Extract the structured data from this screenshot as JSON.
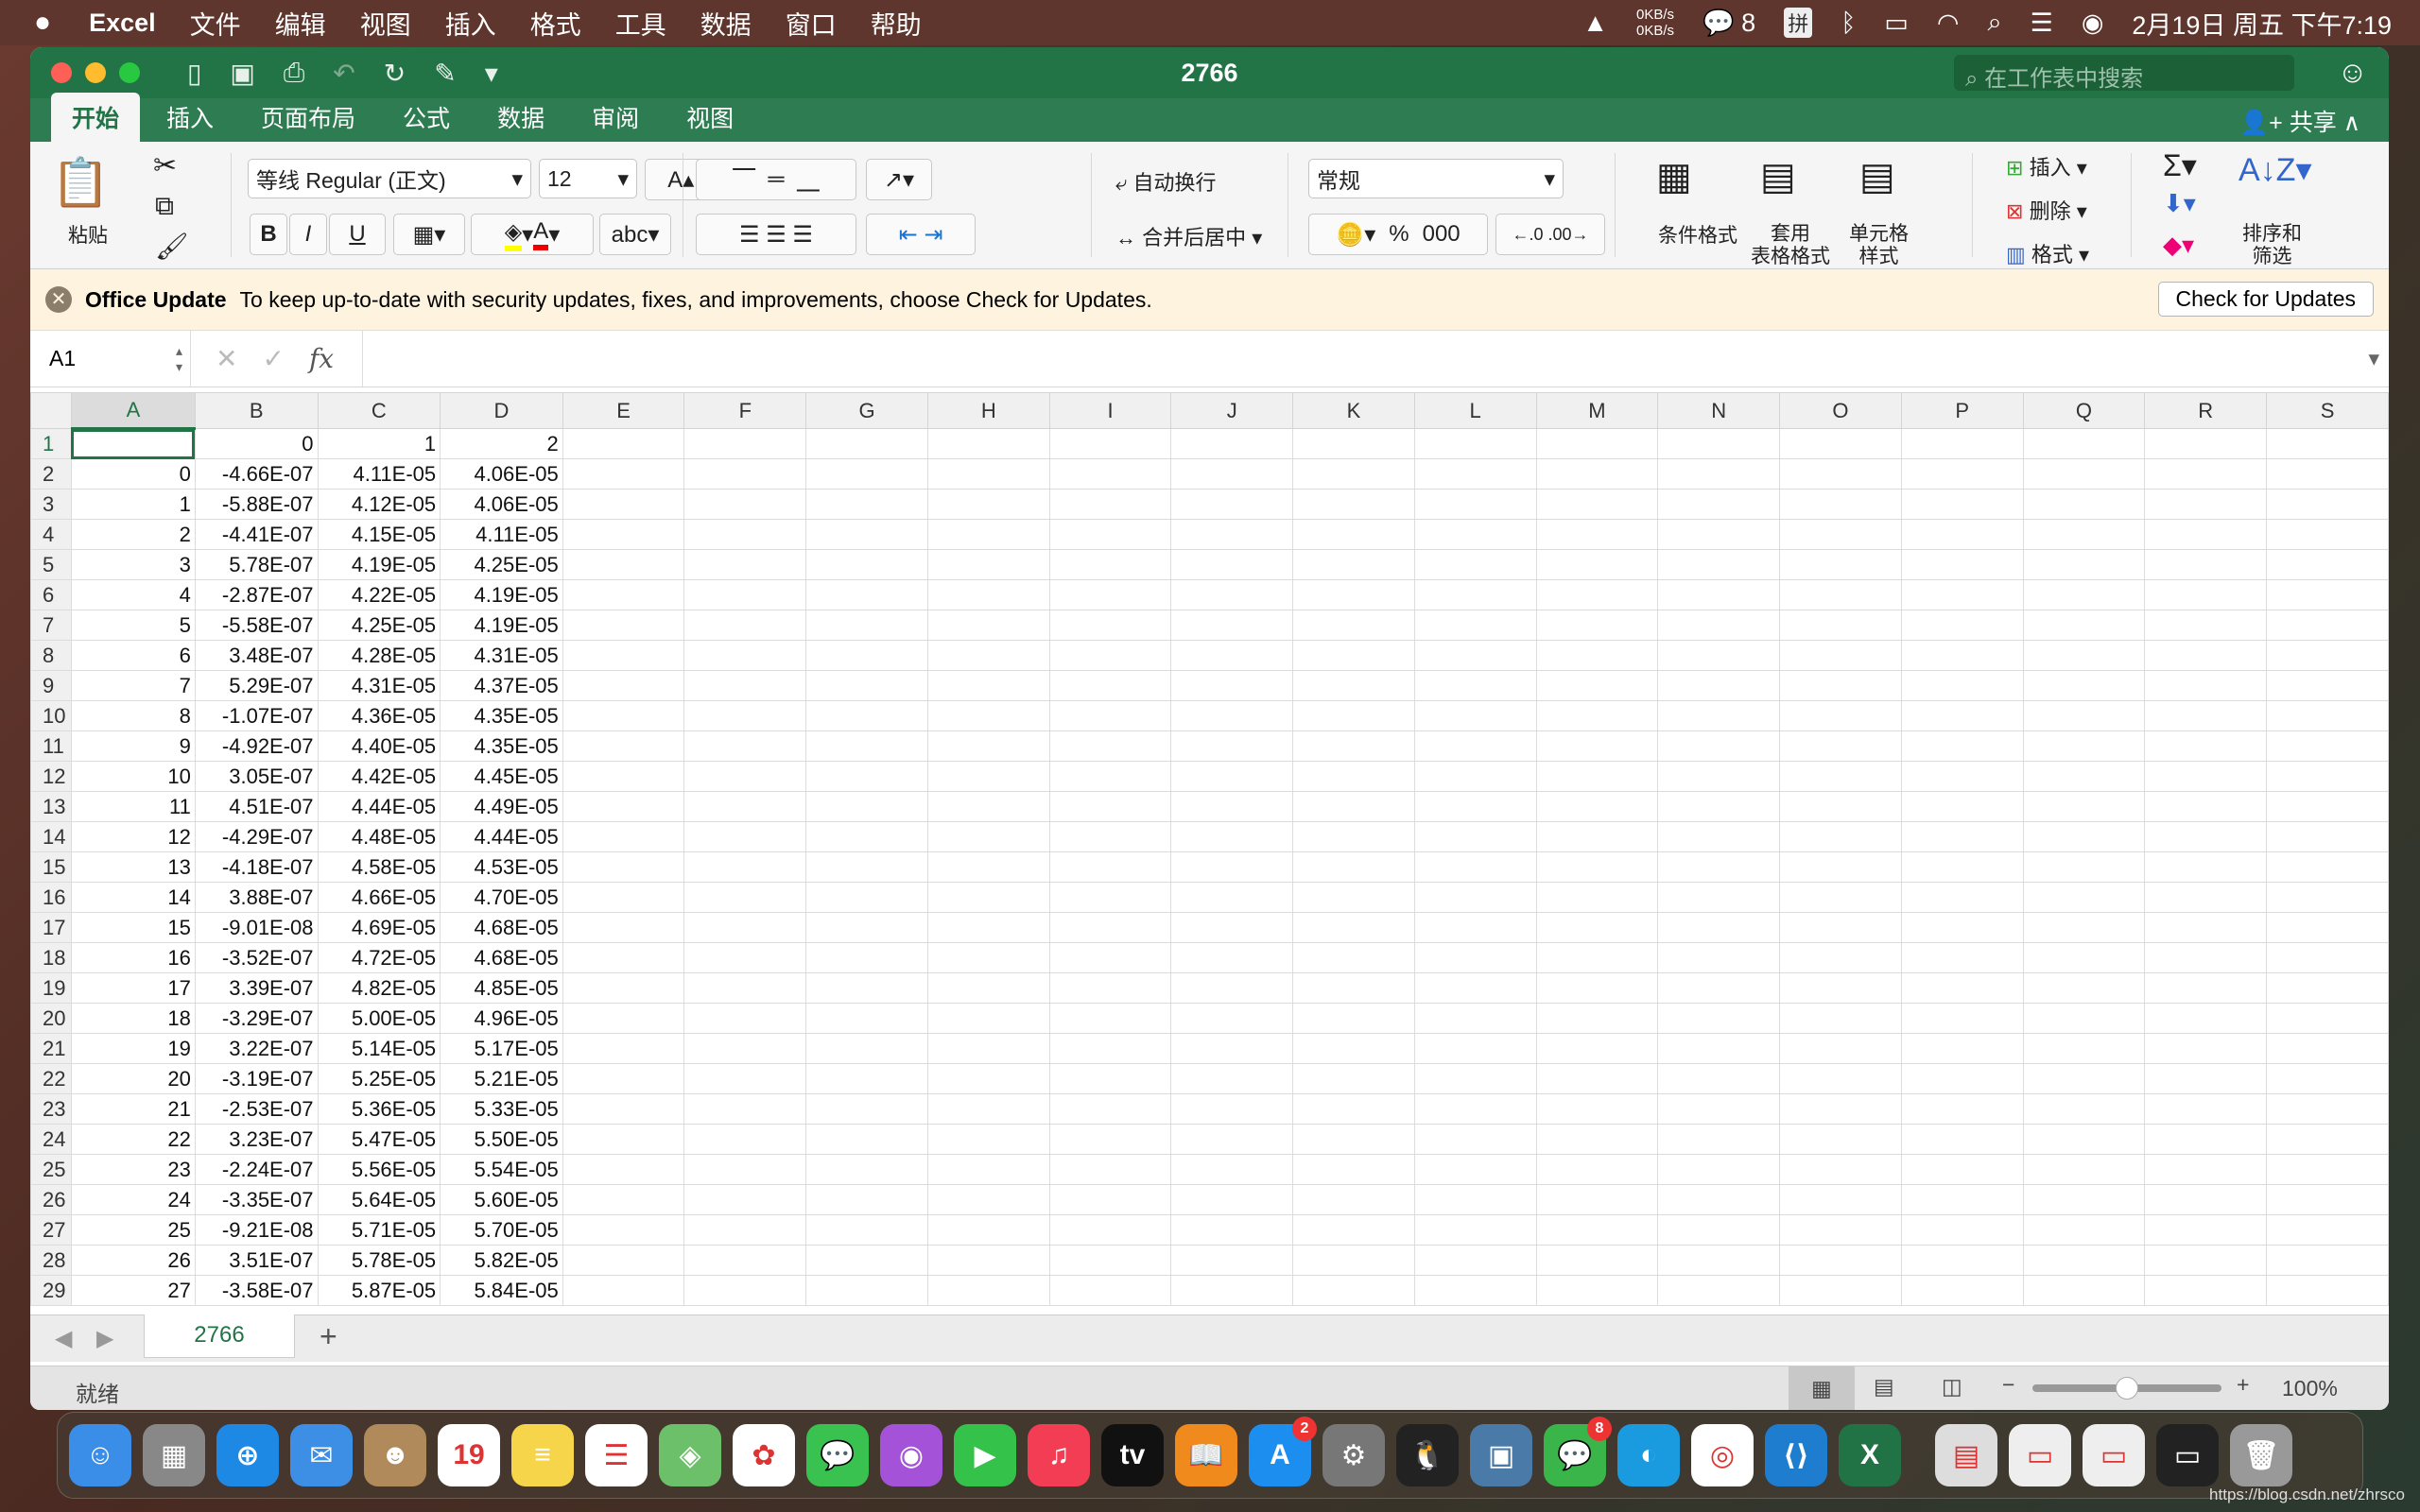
{
  "menubar": {
    "app": "Excel",
    "items": [
      "文件",
      "编辑",
      "视图",
      "插入",
      "格式",
      "工具",
      "数据",
      "窗口",
      "帮助"
    ],
    "net_up": "0KB/s",
    "net_down": "0KB/s",
    "wechat_count": "8",
    "ime": "拼",
    "clock": "2月19日 周五 下午7:19"
  },
  "window": {
    "title": "2766",
    "search_placeholder": "在工作表中搜索",
    "share": "共享"
  },
  "tabs": [
    "开始",
    "插入",
    "页面布局",
    "公式",
    "数据",
    "审阅",
    "视图"
  ],
  "ribbon": {
    "paste": "粘贴",
    "font": "等线 Regular (正文)",
    "size": "12",
    "bold": "B",
    "italic": "I",
    "underline": "U",
    "wrap": "自动换行",
    "merge": "合并后居中",
    "number_format": "常规",
    "percent": "%",
    "thousands": "000",
    "cond_format": "条件格式",
    "table_format_1": "套用",
    "table_format_2": "表格格式",
    "cell_style_1": "单元格",
    "cell_style_2": "样式",
    "insert": "插入",
    "delete": "删除",
    "format": "格式",
    "sort_1": "排序和",
    "sort_2": "筛选"
  },
  "update_bar": {
    "title": "Office Update",
    "message": "To keep up-to-date with security updates, fixes, and improvements, choose Check for Updates.",
    "button": "Check for Updates"
  },
  "formula_bar": {
    "name_box": "A1",
    "fx": "fx",
    "value": ""
  },
  "sheet": {
    "columns": [
      "A",
      "B",
      "C",
      "D",
      "E",
      "F",
      "G",
      "H",
      "I",
      "J",
      "K",
      "L",
      "M",
      "N",
      "O",
      "P",
      "Q",
      "R",
      "S"
    ],
    "selected": "A1",
    "rows": [
      [
        "",
        "0",
        "1",
        "2"
      ],
      [
        "0",
        "-4.66E-07",
        "4.11E-05",
        "4.06E-05"
      ],
      [
        "1",
        "-5.88E-07",
        "4.12E-05",
        "4.06E-05"
      ],
      [
        "2",
        "-4.41E-07",
        "4.15E-05",
        "4.11E-05"
      ],
      [
        "3",
        "5.78E-07",
        "4.19E-05",
        "4.25E-05"
      ],
      [
        "4",
        "-2.87E-07",
        "4.22E-05",
        "4.19E-05"
      ],
      [
        "5",
        "-5.58E-07",
        "4.25E-05",
        "4.19E-05"
      ],
      [
        "6",
        "3.48E-07",
        "4.28E-05",
        "4.31E-05"
      ],
      [
        "7",
        "5.29E-07",
        "4.31E-05",
        "4.37E-05"
      ],
      [
        "8",
        "-1.07E-07",
        "4.36E-05",
        "4.35E-05"
      ],
      [
        "9",
        "-4.92E-07",
        "4.40E-05",
        "4.35E-05"
      ],
      [
        "10",
        "3.05E-07",
        "4.42E-05",
        "4.45E-05"
      ],
      [
        "11",
        "4.51E-07",
        "4.44E-05",
        "4.49E-05"
      ],
      [
        "12",
        "-4.29E-07",
        "4.48E-05",
        "4.44E-05"
      ],
      [
        "13",
        "-4.18E-07",
        "4.58E-05",
        "4.53E-05"
      ],
      [
        "14",
        "3.88E-07",
        "4.66E-05",
        "4.70E-05"
      ],
      [
        "15",
        "-9.01E-08",
        "4.69E-05",
        "4.68E-05"
      ],
      [
        "16",
        "-3.52E-07",
        "4.72E-05",
        "4.68E-05"
      ],
      [
        "17",
        "3.39E-07",
        "4.82E-05",
        "4.85E-05"
      ],
      [
        "18",
        "-3.29E-07",
        "5.00E-05",
        "4.96E-05"
      ],
      [
        "19",
        "3.22E-07",
        "5.14E-05",
        "5.17E-05"
      ],
      [
        "20",
        "-3.19E-07",
        "5.25E-05",
        "5.21E-05"
      ],
      [
        "21",
        "-2.53E-07",
        "5.36E-05",
        "5.33E-05"
      ],
      [
        "22",
        "3.23E-07",
        "5.47E-05",
        "5.50E-05"
      ],
      [
        "23",
        "-2.24E-07",
        "5.56E-05",
        "5.54E-05"
      ],
      [
        "24",
        "-3.35E-07",
        "5.64E-05",
        "5.60E-05"
      ],
      [
        "25",
        "-9.21E-08",
        "5.71E-05",
        "5.70E-05"
      ],
      [
        "26",
        "3.51E-07",
        "5.78E-05",
        "5.82E-05"
      ],
      [
        "27",
        "-3.58E-07",
        "5.87E-05",
        "5.84E-05"
      ]
    ],
    "tab": "2766",
    "add_sheet": "+"
  },
  "status": {
    "text": "就绪",
    "zoom": "100%",
    "zoom_percent": 100
  },
  "dock": {
    "apps": [
      {
        "name": "finder",
        "color": "#3b8ee8",
        "glyph": "☺"
      },
      {
        "name": "launchpad",
        "color": "#888",
        "glyph": "▦"
      },
      {
        "name": "safari",
        "color": "#1e88e5",
        "glyph": "⊕"
      },
      {
        "name": "mail",
        "color": "#3d8fe6",
        "glyph": "✉"
      },
      {
        "name": "contacts",
        "color": "#b08a5a",
        "glyph": "☻"
      },
      {
        "name": "calendar",
        "color": "#fff",
        "glyph": "19"
      },
      {
        "name": "notes",
        "color": "#f6d54a",
        "glyph": "≡"
      },
      {
        "name": "reminders",
        "color": "#fff",
        "glyph": "☰"
      },
      {
        "name": "maps",
        "color": "#6cc06a",
        "glyph": "◈"
      },
      {
        "name": "photos",
        "color": "#fff",
        "glyph": "✿"
      },
      {
        "name": "messages",
        "color": "#3ac250",
        "glyph": "💬"
      },
      {
        "name": "podcasts",
        "color": "#a453d8",
        "glyph": "◉"
      },
      {
        "name": "facetime",
        "color": "#35c24a",
        "glyph": "▶"
      },
      {
        "name": "music",
        "color": "#f33d54",
        "glyph": "♫"
      },
      {
        "name": "tv",
        "color": "#111",
        "glyph": "tv"
      },
      {
        "name": "books",
        "color": "#f08a1c",
        "glyph": "📖"
      },
      {
        "name": "app-store",
        "color": "#1c8ef0",
        "glyph": "A",
        "badge": "2"
      },
      {
        "name": "system-preferences",
        "color": "#777",
        "glyph": "⚙"
      },
      {
        "name": "qq",
        "color": "#222",
        "glyph": "🐧"
      },
      {
        "name": "preview",
        "color": "#4a7aa8",
        "glyph": "▣"
      },
      {
        "name": "wechat",
        "color": "#3ab54a",
        "glyph": "💬",
        "badge": "8"
      },
      {
        "name": "network-app",
        "color": "#1a9be0",
        "glyph": "◐"
      },
      {
        "name": "chrome",
        "color": "#fff",
        "glyph": "◎"
      },
      {
        "name": "vscode",
        "color": "#1f7dd0",
        "glyph": "⟨⟩"
      },
      {
        "name": "excel",
        "color": "#217346",
        "glyph": "X"
      },
      {
        "name": "document",
        "color": "#ddd",
        "glyph": "▤"
      },
      {
        "name": "chrome-window",
        "color": "#eee",
        "glyph": "▭"
      },
      {
        "name": "wechat-window",
        "color": "#eee",
        "glyph": "▭"
      },
      {
        "name": "vscode-window",
        "color": "#222",
        "glyph": "▭"
      },
      {
        "name": "trash",
        "color": "#999",
        "glyph": "🗑"
      }
    ],
    "watermark": "https://blog.csdn.net/zhrsco"
  }
}
